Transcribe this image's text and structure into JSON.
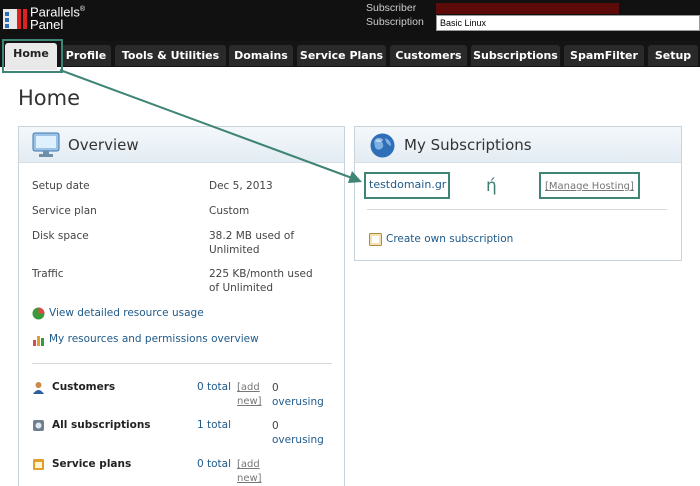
{
  "logo": {
    "line1": "Parallels",
    "reg": "®",
    "line2": "Panel"
  },
  "subscriber": {
    "label": "Subscriber",
    "sub_label": "Subscription",
    "subscription_value": "Basic Linux"
  },
  "nav": {
    "tabs": [
      {
        "label": "Home",
        "active": true
      },
      {
        "label": "Profile"
      },
      {
        "label": "Tools & Utilities"
      },
      {
        "label": "Domains"
      },
      {
        "label": "Service Plans"
      },
      {
        "label": "Customers"
      },
      {
        "label": "Subscriptions"
      },
      {
        "label": "SpamFilter"
      },
      {
        "label": "Setup"
      }
    ]
  },
  "page_title": "Home",
  "overview": {
    "title": "Overview",
    "rows": [
      {
        "label": "Setup date",
        "value": "Dec 5, 2013"
      },
      {
        "label": "Service plan",
        "value": "Custom"
      },
      {
        "label": "Disk space",
        "value": "38.2 MB used of Unlimited"
      },
      {
        "label": "Traffic",
        "value": "225 KB/month used of Unlimited"
      }
    ],
    "link_resource_usage": "View detailed resource usage",
    "link_permissions": "My resources and permissions overview",
    "stats": [
      {
        "label": "Customers",
        "total": "0 total",
        "add1": "[add",
        "add2": "new]",
        "over1": "0",
        "over2": "overusing"
      },
      {
        "label": "All subscriptions",
        "total": "1 total",
        "over1": "0",
        "over2": "overusing"
      },
      {
        "label": "Service plans",
        "total": "0 total",
        "add1": "[add",
        "add2": "new]"
      }
    ]
  },
  "my_subscriptions": {
    "title": "My Subscriptions",
    "domain": "testdomain.gr",
    "annotation": "ή",
    "manage_hosting": "[Manage Hosting]",
    "create_link": "Create own subscription"
  },
  "colors": {
    "highlight": "#3f8575",
    "link": "#1f5a8a",
    "topbar": "#111111"
  }
}
